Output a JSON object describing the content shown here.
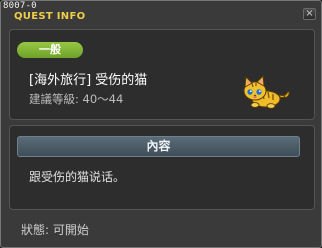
{
  "window": {
    "quest_id": "8007-0",
    "title": "QUEST INFO",
    "close_label": "×"
  },
  "quest": {
    "badge": "一般",
    "title": "[海外旅行] 受伤的猫",
    "level": "建議等級: 40～44",
    "npc_icon": "wounded-cat-icon"
  },
  "content": {
    "header": "內容",
    "text": "跟受伤的猫说话。"
  },
  "status": {
    "text": "狀態:  可開始"
  },
  "colors": {
    "title_yellow": "#f0cf48",
    "badge_green": "#7fb332",
    "header_blue_gray": "#4e5f6a",
    "panel_bg": "#2d2d2d",
    "window_bg": "#3a3a3a"
  }
}
